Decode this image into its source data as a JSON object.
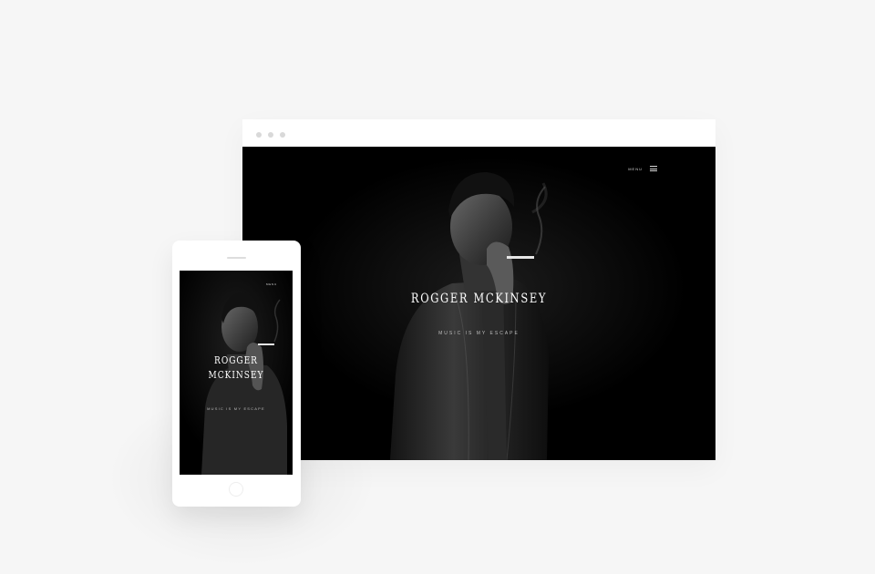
{
  "desktop": {
    "menu_label": "MENU",
    "hero_title": "ROGGER MCKINSEY",
    "hero_tagline": "MUSIC IS MY ESCAPE"
  },
  "mobile": {
    "menu_label": "MENU",
    "hero_title_line1": "ROGGER",
    "hero_title_line2": "MCKINSEY",
    "hero_tagline": "MUSIC IS MY ESCAPE"
  },
  "colors": {
    "page_background": "#f6f6f6",
    "device_frame": "#ffffff",
    "screen_background": "#000000",
    "hero_text": "#ffffff",
    "window_dots": "#d9d9d9"
  },
  "icons": {
    "menu": "hamburger-icon",
    "window_controls": "window-dot-icon"
  }
}
